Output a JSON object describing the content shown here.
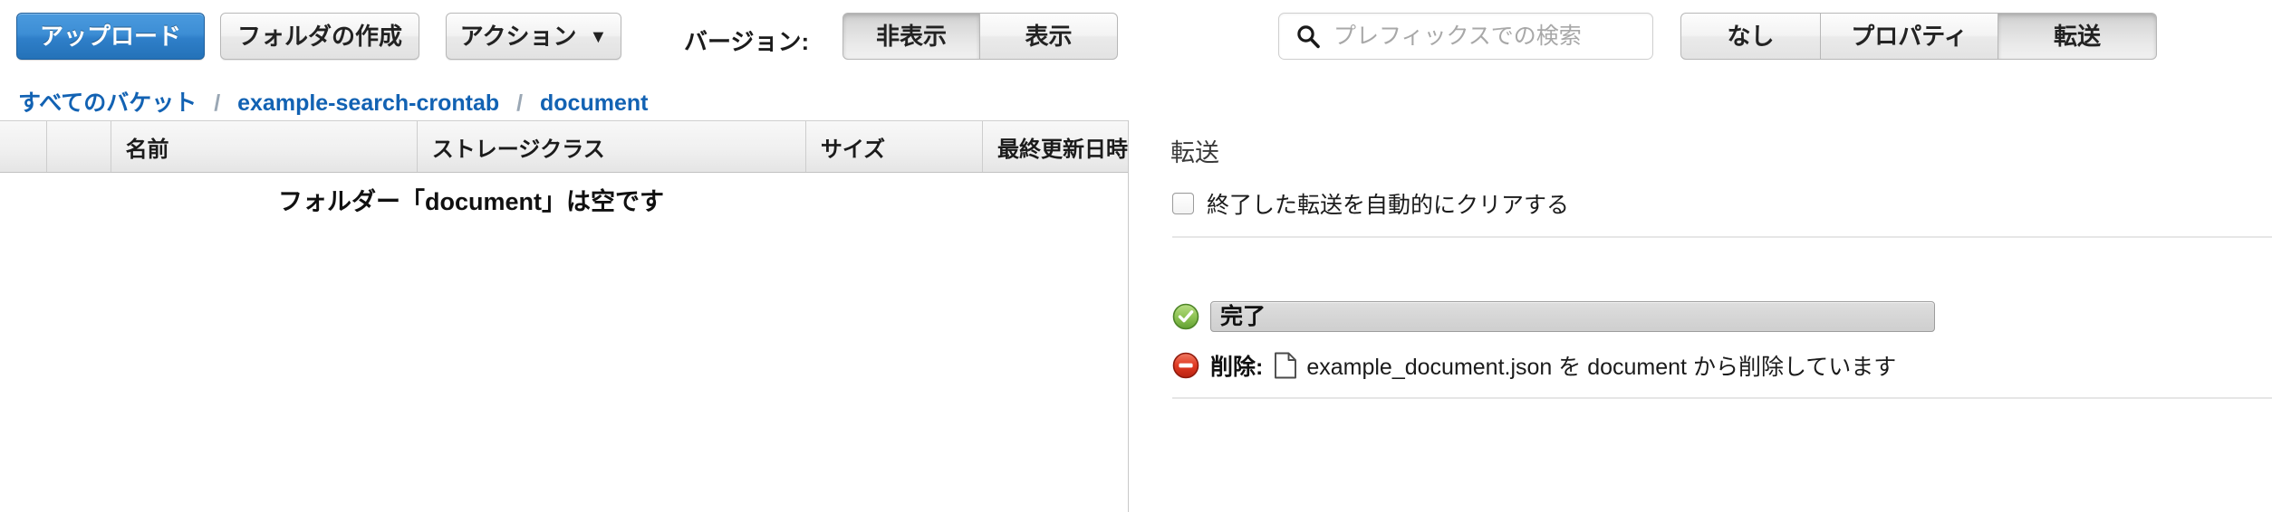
{
  "toolbar": {
    "upload_label": "アップロード",
    "new_folder_label": "フォルダの作成",
    "actions_label": "アクション",
    "actions_caret": "▼",
    "version_label": "バージョン:",
    "version_options": [
      {
        "label": "非表示",
        "active": true
      },
      {
        "label": "表示",
        "active": false
      }
    ],
    "search_placeholder": "プレフィックスでの検索",
    "search_value": "",
    "panel_tabs": [
      {
        "label": "なし",
        "active": false
      },
      {
        "label": "プロパティ",
        "active": false
      },
      {
        "label": "転送",
        "active": true
      }
    ]
  },
  "breadcrumb": {
    "items": [
      {
        "label": "すべてのバケット"
      },
      {
        "label": "example-search-crontab"
      },
      {
        "label": "document"
      }
    ],
    "separator": "/"
  },
  "file_table": {
    "columns": [
      "",
      "",
      "名前",
      "ストレージクラス",
      "サイズ",
      "最終更新日時"
    ],
    "rows": [],
    "empty_message": "フォルダー「document」は空です"
  },
  "transfers_panel": {
    "title": "転送",
    "auto_clear_label": "終了した転送を自動的にクリアする",
    "auto_clear_checked": false,
    "progress": {
      "status_icon": "check-circle-green-icon",
      "label": "完了",
      "percent": 100
    },
    "status": {
      "status_icon": "minus-circle-red-icon",
      "action_label": "削除:",
      "file_icon": "document-file-icon",
      "file_name": "example_document.json",
      "message": "example_document.json を document から削除しています"
    }
  },
  "colors": {
    "primary_button": "#2f7fc9",
    "link": "#1262b3",
    "success": "#7db94a",
    "danger": "#d83a2b",
    "progress_track": "#d6d6d6"
  }
}
